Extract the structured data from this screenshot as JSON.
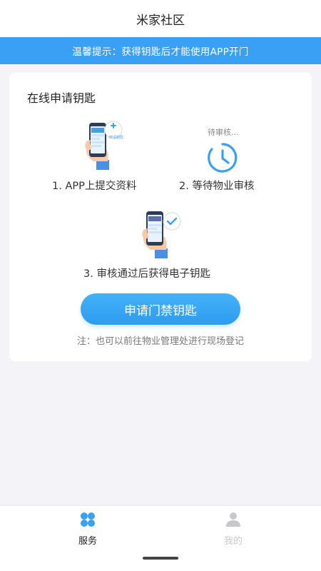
{
  "header": {
    "title": "米家社区"
  },
  "notice": {
    "text": "温馨提示：获得钥匙后才能使用APP开门"
  },
  "card": {
    "title": "在线申请钥匙",
    "steps": [
      {
        "label": "1. APP上提交资料",
        "icon": "phone-submit-icon",
        "phone_badge": "申请钥匙"
      },
      {
        "label": "2. 等待物业审核",
        "icon": "clock-icon",
        "status": "待审核..."
      },
      {
        "label": "3. 审核通过后获得电子钥匙",
        "icon": "phone-approved-icon"
      }
    ],
    "apply_button": "申请门禁钥匙",
    "note": "注：也可以前往物业管理处进行现场登记"
  },
  "tabbar": {
    "items": [
      {
        "label": "服务",
        "icon": "grid-clover-icon",
        "active": true
      },
      {
        "label": "我的",
        "icon": "person-icon",
        "active": false
      }
    ]
  },
  "colors": {
    "accent": "#3aa0f4",
    "inactive": "#c8c8cc"
  }
}
